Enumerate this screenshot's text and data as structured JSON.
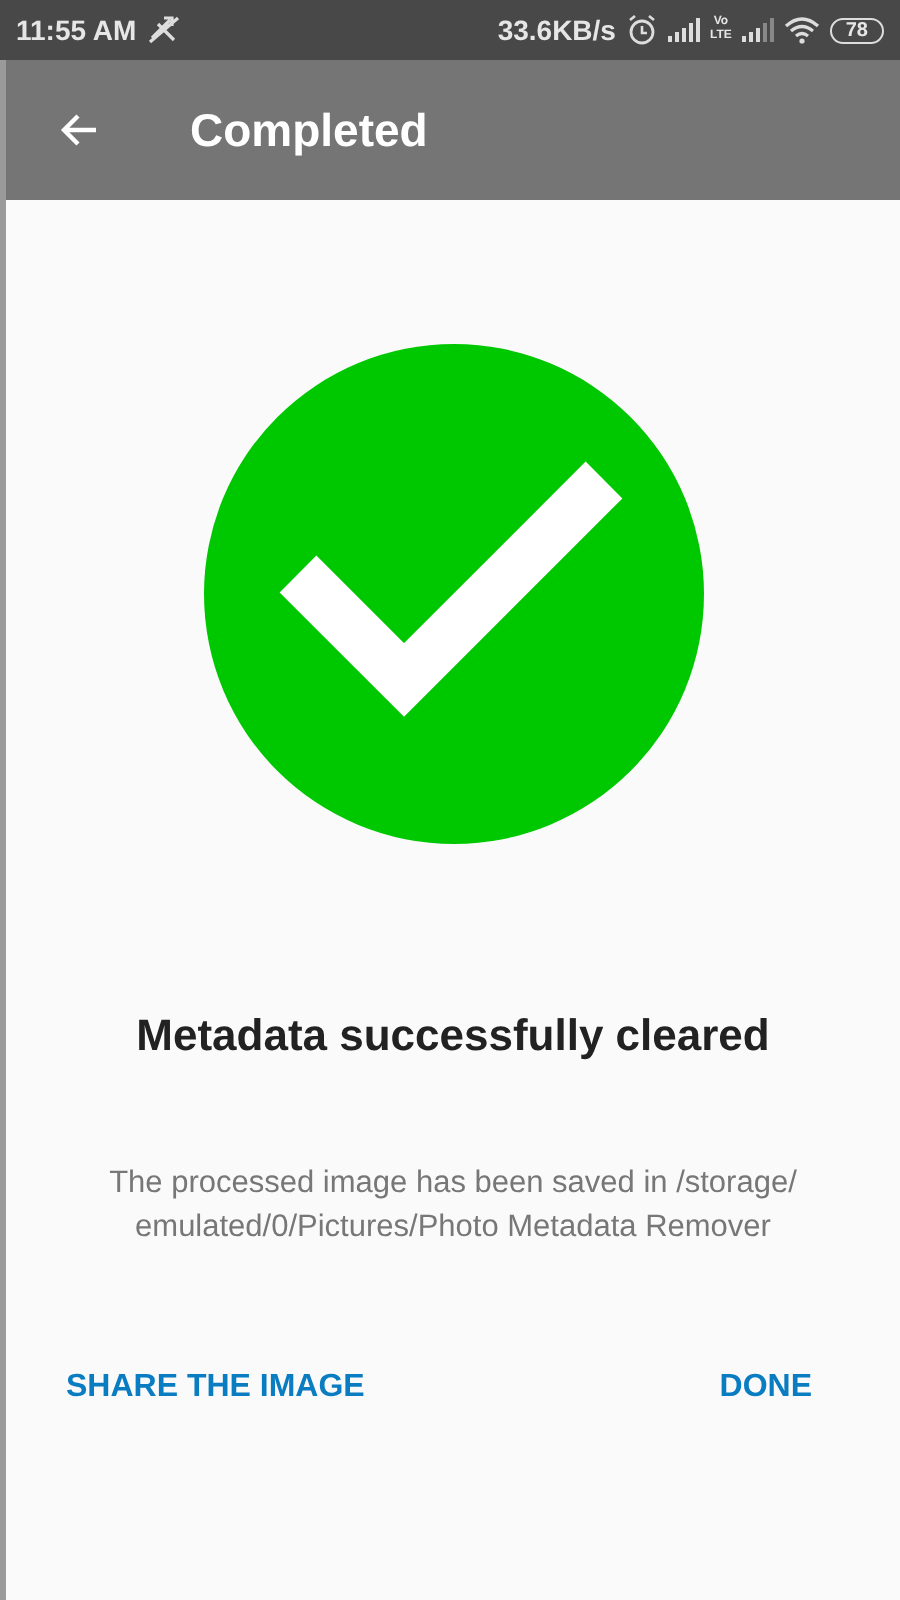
{
  "status_bar": {
    "time": "11:55 AM",
    "speed": "33.6KB/s",
    "network_badge": [
      "Vo",
      "LTE"
    ],
    "battery": "78"
  },
  "app_bar": {
    "title": "Completed"
  },
  "result": {
    "title": "Metadata successfully cleared",
    "message": "The processed image has been saved in /storage/ emulated/0/Pictures/Photo Metadata Remover"
  },
  "actions": [
    {
      "label": "SHARE THE IMAGE"
    },
    {
      "label": "DONE"
    }
  ]
}
